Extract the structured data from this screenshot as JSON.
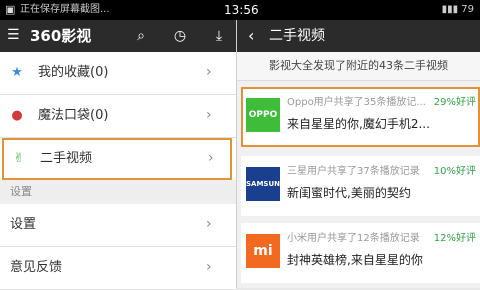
{
  "status_bar": {
    "left_text": "正在保存屏幕截图...",
    "time": "13:56",
    "battery": "79"
  },
  "left_panel": {
    "logo": "360影视",
    "menu_items": [
      {
        "label": "我的收藏(0)",
        "icon": "star-icon",
        "color": "#3d8bd8"
      },
      {
        "label": "魔法口袋(0)",
        "icon": "pocket-icon",
        "color": "#d23b3b"
      },
      {
        "label": "二手视频",
        "icon": "thumb-icon",
        "color": "#4ab04a"
      }
    ],
    "section_label": "设置",
    "settings_items": [
      {
        "label": "设置"
      },
      {
        "label": "意见反馈"
      }
    ]
  },
  "right_panel": {
    "title": "二手视频",
    "notice": "影视大全发现了附近的43条二手视频",
    "cards": [
      {
        "brand": "OPPO",
        "brand_color": "#3fbd3a",
        "meta": "Oppo用户共享了35条播放记...",
        "rating": "29%好评",
        "title": "来自星星的你,魔幻手机2..."
      },
      {
        "brand": "SAMSUNG",
        "brand_color": "#1b3f8f",
        "meta": "三星用户共享了37条播放记录",
        "rating": "10%好评",
        "title": "新闺蜜时代,美丽的契约"
      },
      {
        "brand": "mi",
        "brand_color": "#f26a21",
        "meta": "小米用户共享了12条播放记录",
        "rating": "12%好评",
        "title": "封神英雄榜,来自星星的你"
      }
    ]
  }
}
